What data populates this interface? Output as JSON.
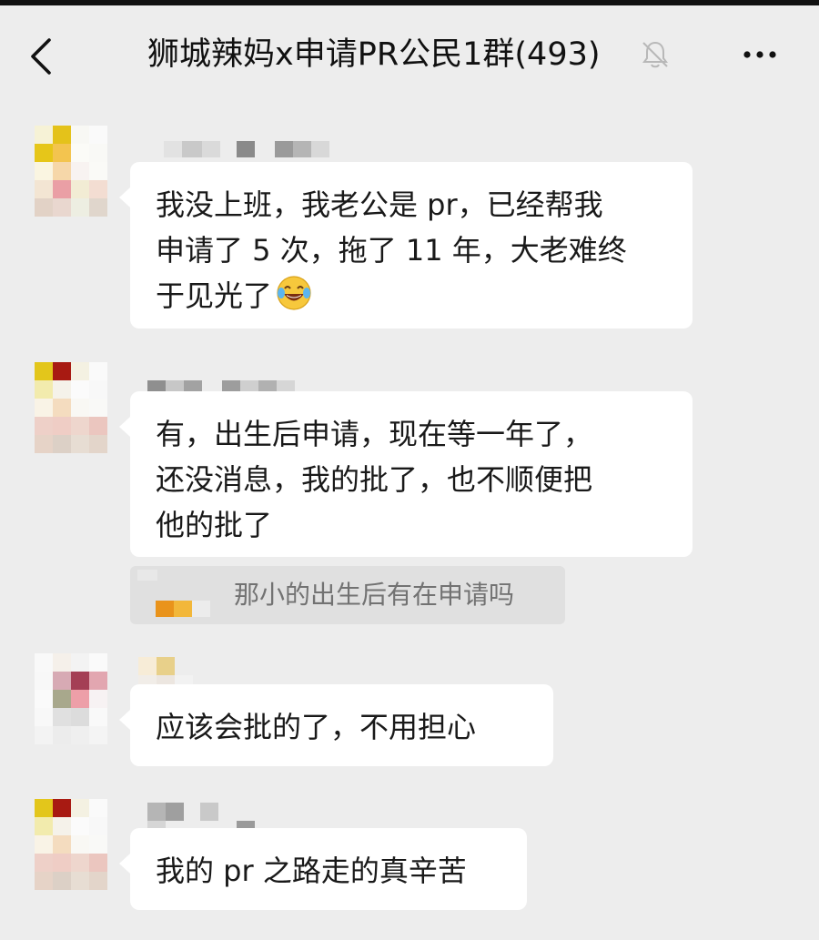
{
  "header": {
    "title": "狮城辣妈x申请PR公民1群(493)",
    "back_icon": "chevron-left-icon",
    "mute_icon": "bell-muted-icon",
    "more_icon": "ellipsis-icon"
  },
  "messages": [
    {
      "text": "我没上班，我老公是 pr，已经帮我\n申请了 5 次，拖了 11 年，大老难终\n于见光了",
      "emoji": "laughing-tears-emoji"
    },
    {
      "text": "有，出生后申请，现在等一年了，\n还没消息，我的批了，也不顺便把\n他的批了"
    },
    {
      "text": "应该会批的了，不用担心"
    },
    {
      "text": "我的 pr 之路走的真辛苦"
    }
  ],
  "quote": {
    "text": "那小的出生后有在申请吗"
  },
  "colors": {
    "background": "#ededed",
    "bubble": "#ffffff",
    "quote_bg": "#e0e0e0",
    "text": "#191919",
    "quote_text": "#727272"
  }
}
